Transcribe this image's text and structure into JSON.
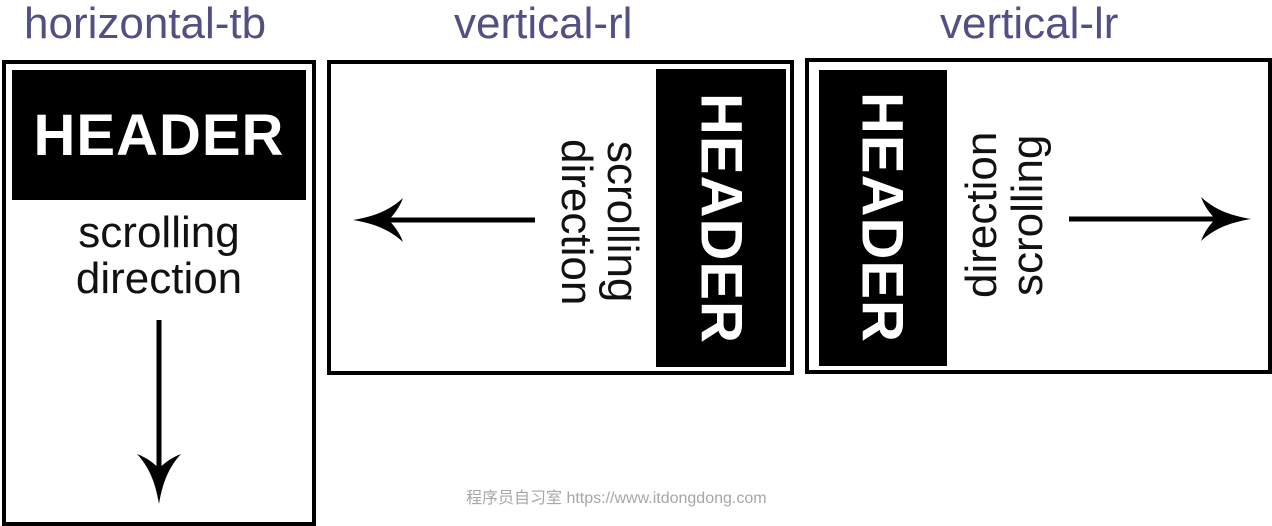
{
  "panels": [
    {
      "mode": "horizontal-tb",
      "header": "HEADER",
      "scroll_line1": "scrolling",
      "scroll_line2": "direction"
    },
    {
      "mode": "vertical-rl",
      "header": "HEADER",
      "scroll_line1": "scrolling",
      "scroll_line2": "direction"
    },
    {
      "mode": "vertical-lr",
      "header": "HEADER",
      "scroll_line1": "scrolling",
      "scroll_line2": "direction"
    }
  ],
  "watermark": "程序员自习室 https://www.itdongdong.com",
  "colors": {
    "title": "#524f83",
    "header_bg": "#000000",
    "header_text": "#ffffff",
    "border": "#000000"
  }
}
